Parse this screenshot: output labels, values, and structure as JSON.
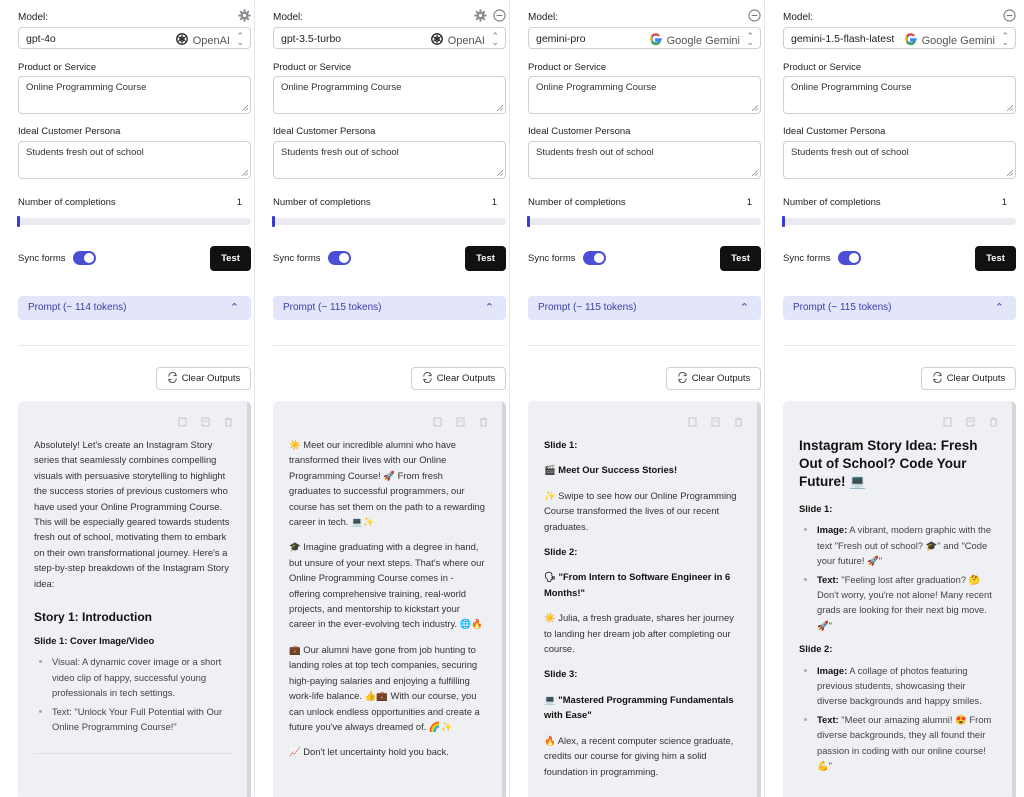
{
  "labels": {
    "model": "Model:",
    "product": "Product or Service",
    "persona": "Ideal Customer Persona",
    "completions": "Number of completions",
    "sync": "Sync forms",
    "test": "Test",
    "clear": "Clear Outputs"
  },
  "columns": [
    {
      "model": "gpt-4o",
      "provider": "OpenAI",
      "provider_icon": "openai-icon",
      "product": "Online Programming Course",
      "persona": "Students fresh out of school",
      "completions": "1",
      "prompt": "Prompt (~ 114 tokens)",
      "output": {
        "p1": "Absolutely! Let's create an Instagram Story series that seamlessly combines compelling visuals with persuasive storytelling to highlight the success stories of previous customers who have used your Online Programming Course. This will be especially geared towards students fresh out of school, motivating them to embark on their own transformational journey. Here's a step-by-step breakdown of the Instagram Story idea:",
        "h": "Story 1: Introduction",
        "s": "Slide 1: Cover Image/Video",
        "li1": "Visual: A dynamic cover image or a short video clip of happy, successful young professionals in tech settings.",
        "li2": "Text: \"Unlock Your Full Potential with Our Online Programming Course!\""
      }
    },
    {
      "model": "gpt-3.5-turbo",
      "provider": "OpenAI",
      "provider_icon": "openai-icon",
      "product": "Online Programming Course",
      "persona": "Students fresh out of school",
      "completions": "1",
      "prompt": "Prompt (~ 115 tokens)",
      "output": {
        "p1": "☀️ Meet our incredible alumni who have transformed their lives with our Online Programming Course! 🚀 From fresh graduates to successful programmers, our course has set them on the path to a rewarding career in tech. 💻✨",
        "p2": "🎓 Imagine graduating with a degree in hand, but unsure of your next steps. That's where our Online Programming Course comes in - offering comprehensive training, real-world projects, and mentorship to kickstart your career in the ever-evolving tech industry. 🌐🔥",
        "p3": "💼 Our alumni have gone from job hunting to landing roles at top tech companies, securing high-paying salaries and enjoying a fulfilling work-life balance. 👍💼 With our course, you can unlock endless opportunities and create a future you've always dreamed of. 🌈✨",
        "p4": "📈 Don't let uncertainty hold you back."
      }
    },
    {
      "model": "gemini-pro",
      "provider": "Google Gemini",
      "provider_icon": "google-icon",
      "product": "Online Programming Course",
      "persona": "Students fresh out of school",
      "completions": "1",
      "prompt": "Prompt (~ 115 tokens)",
      "output": {
        "s1": "Slide 1:",
        "s1h": "🎬 Meet Our Success Stories!",
        "s1p": "✨ Swipe to see how our Online Programming Course transformed the lives of our recent graduates.",
        "s2": "Slide 2:",
        "s2h": "🗣 \"From Intern to Software Engineer in 6 Months!\"",
        "s2p": "☀️ Julia, a fresh graduate, shares her journey to landing her dream job after completing our course.",
        "s3": "Slide 3:",
        "s3h": "💻 \"Mastered Programming Fundamentals with Ease\"",
        "s3p": "🔥 Alex, a recent computer science graduate, credits our course for giving him a solid foundation in programming."
      }
    },
    {
      "model": "gemini-1.5-flash-latest",
      "provider": "Google Gemini",
      "provider_icon": "google-icon",
      "product": "Online Programming Course",
      "persona": "Students fresh out of school",
      "completions": "1",
      "prompt": "Prompt (~ 115 tokens)",
      "output": {
        "h": "Instagram Story Idea: Fresh Out of School? Code Your Future! 💻",
        "s1": "Slide 1:",
        "li1b": "Image:",
        "li1": " A vibrant, modern graphic with the text \"Fresh out of school? 🎓\" and \"Code your future! 🚀\"",
        "li2b": "Text:",
        "li2": " \"Feeling lost after graduation? 🤔 Don't worry, you're not alone! Many recent grads are looking for their next big move. 🚀\"",
        "s2": "Slide 2:",
        "li3b": "Image:",
        "li3": " A collage of photos featuring previous students, showcasing their diverse backgrounds and happy smiles.",
        "li4b": "Text:",
        "li4": " \"Meet our amazing alumni! 😍 From diverse backgrounds, they all found their passion in coding with our online course! 💪\""
      }
    }
  ]
}
